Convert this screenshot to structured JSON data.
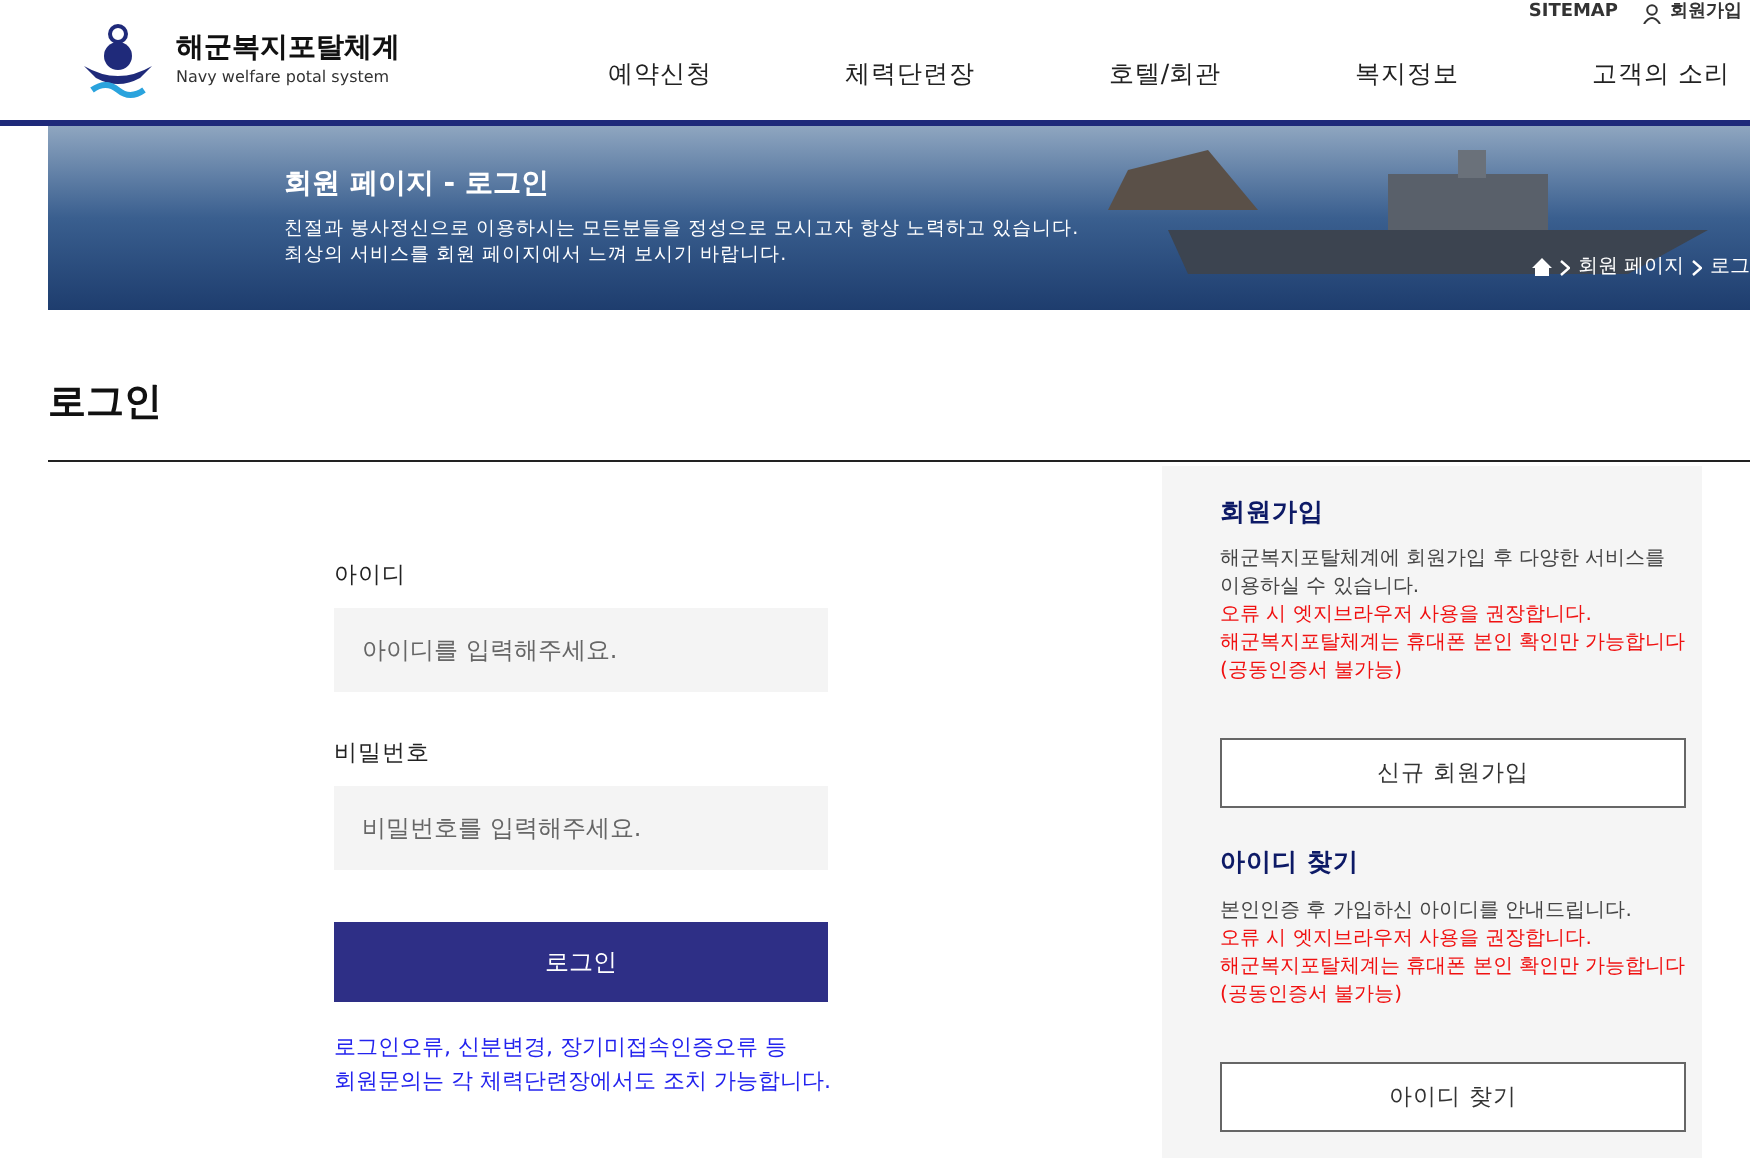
{
  "header": {
    "logo": {
      "title": "해군복지포탈체계",
      "subtitle": "Navy welfare potal system"
    },
    "utility_links": [
      {
        "kind": "text",
        "label": "SITEMAP"
      },
      {
        "kind": "user",
        "label": "회원가입"
      }
    ],
    "nav": [
      "예약신청",
      "체력단련장",
      "호텔/회관",
      "복지정보",
      "고객의 소리"
    ]
  },
  "banner": {
    "title": "회원 페이지 - 로그인",
    "lines": [
      "친절과 봉사정신으로 이용하시는 모든분들을 정성으로 모시고자 항상 노력하고 있습니다.",
      "최상의 서비스를 회원 페이지에서 느껴 보시기 바랍니다."
    ],
    "breadcrumb": [
      "회원 페이지",
      "로그"
    ]
  },
  "page_title": "로그인",
  "login_form": {
    "fields": [
      {
        "label": "아이디",
        "placeholder": "아이디를 입력해주세요."
      },
      {
        "label": "비밀번호",
        "placeholder": "비밀번호를 입력해주세요."
      }
    ],
    "submit": "로그인",
    "notice": [
      "로그인오류, 신분변경, 장기미접속인증오류 등",
      "회원문의는 각 체력단련장에서도 조치 가능합니다."
    ]
  },
  "side_panel": [
    {
      "title": "회원가입",
      "description": "해군복지포탈체계에 회원가입 후 다양한 서비스를 이용하실 수 있습니다.",
      "warnings": [
        "오류 시 엣지브라우저 사용을 권장합니다.",
        "해군복지포탈체계는 휴대폰 본인 확인만 가능합니다(공동인증서 불가능)"
      ],
      "button": "신규 회원가입"
    },
    {
      "title": "아이디 찾기",
      "description": "본인인증 후 가입하신 아이디를 안내드립니다.",
      "warnings": [
        "오류 시 엣지브라우저 사용을 권장합니다.",
        "해군복지포탈체계는 휴대폰 본인 확인만 가능합니다(공동인증서 불가능)"
      ],
      "button": "아이디 찾기"
    }
  ]
}
